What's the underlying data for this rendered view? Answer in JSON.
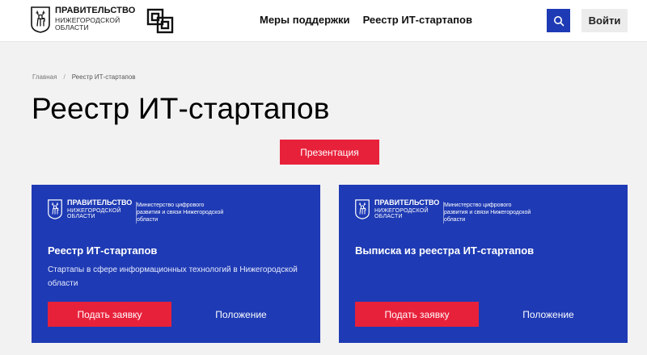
{
  "header": {
    "gov_title": "ПРАВИТЕЛЬСТВО",
    "gov_region": "НИЖЕГОРОДСКОЙ ОБЛАСТИ",
    "nav": [
      "Меры поддержки",
      "Реестр ИТ-стартапов"
    ],
    "login_label": "Войти"
  },
  "breadcrumb": {
    "home": "Главная",
    "separator": "/",
    "current": "Реестр ИТ-стартапов"
  },
  "page_title": "Реестр ИТ-стартапов",
  "presentation_label": "Презентация",
  "cards": [
    {
      "gov_title": "ПРАВИТЕЛЬСТВО",
      "gov_region": "НИЖЕГОРОДСКОЙ ОБЛАСТИ",
      "ministry": "Министерство цифрового развития и связи Нижегородской области",
      "title": "Реестр ИТ-стартапов",
      "description": "Стартапы в сфере информационных технологий в Нижегородской области",
      "apply_label": "Подать заявку",
      "rules_label": "Положение"
    },
    {
      "gov_title": "ПРАВИТЕЛЬСТВО",
      "gov_region": "НИЖЕГОРОДСКОЙ ОБЛАСТИ",
      "ministry": "Министерство цифрового развития и связи Нижегородской области",
      "title": "Выписка из реестра ИТ-стартапов",
      "description": "",
      "apply_label": "Подать заявку",
      "rules_label": "Положение"
    }
  ],
  "icons": {
    "crest": "deer-crest-icon",
    "pattern": "square-pattern-logo-icon",
    "search": "search-icon"
  },
  "colors": {
    "primary_blue": "#1e3ab4",
    "accent_red": "#e8213b",
    "background": "#f2f2f2"
  }
}
